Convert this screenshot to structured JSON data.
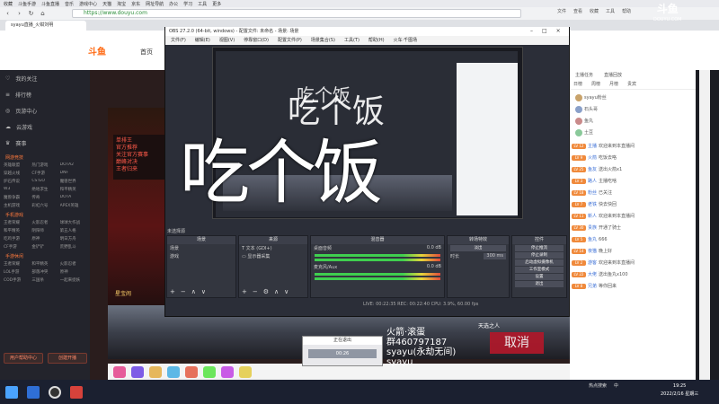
{
  "browser": {
    "bookmarks": [
      "收藏",
      "斗鱼手游",
      "斗鱼直播",
      "音乐",
      "游戏中心",
      "天猫",
      "淘宝",
      "京东",
      "网址导航",
      "办公",
      "学习",
      "工具",
      "更多"
    ],
    "url": "https://www.douyu.com",
    "top_right": [
      "文件",
      "查看",
      "收藏",
      "工具",
      "帮助"
    ],
    "tab_title": "syayu直播_火钳刘明",
    "nav": {
      "back": "‹",
      "forward": "›",
      "refresh": "↻",
      "home": "⌂"
    }
  },
  "douyu": {
    "logo": "斗鱼",
    "home": "首页",
    "sidebar_main": [
      "我的关注",
      "排行榜",
      "页游中心",
      "云游戏",
      "赛事"
    ],
    "sidebar_sections": [
      {
        "title": "网游竞技",
        "items": [
          "英雄联盟",
          "热门游戏",
          "DOTA2",
          "穿越火线",
          "CF手游",
          "DNF",
          "炉石传说",
          "CS:GO",
          "魔兽世界",
          "W3",
          "绝地求生",
          "和平精英",
          "魔兽争霸",
          "传奇",
          "DOTA",
          "主机游戏",
          "彩虹六号",
          "APEX英雄"
        ]
      },
      {
        "title": "手机游戏",
        "items": [
          "王者荣耀",
          "火影忍者",
          "球球大作战",
          "和平精英",
          "阴阳师",
          "第五人格",
          "吃鸡手游",
          "原神",
          "明日方舟",
          "CF手游",
          "金铲铲",
          "荒野乱斗"
        ]
      },
      {
        "title": "手游休闲",
        "items": [
          "王者荣耀",
          "和平精英",
          "火影忍者",
          "LOL手游",
          "部落冲突",
          "原神",
          "COD手游",
          "三国杀",
          "一起来捉妖"
        ]
      }
    ],
    "sidebar_buttons": [
      "用户帮助中心",
      "创建开播"
    ],
    "promo_lines": [
      "单排王",
      "官方推荐",
      "关注官方赛事",
      "巅峰对决",
      "王者归来"
    ],
    "stream_label": "星宝闹"
  },
  "obs": {
    "title": "OBS 27.2.0 (64-bit, windows) - 配置文件: 未命名 - 场景: 场景",
    "menu": [
      "文件(F)",
      "编辑(E)",
      "视图(V)",
      "停靠窗口(D)",
      "配置文件(P)",
      "场景集合(S)",
      "工具(T)",
      "帮助(H)",
      "火车·千图场"
    ],
    "preview_text": "吃个饭",
    "no_source_label": "未选择源",
    "docks": {
      "scenes": {
        "title": "场景",
        "items": [
          "场景",
          "游戏"
        ]
      },
      "sources": {
        "title": "来源",
        "items": [
          "文本 (GDI+)",
          "显示器采集"
        ]
      },
      "mixer": {
        "title": "混音器",
        "tracks": [
          {
            "name": "桌面音频",
            "db": "0.0 dB"
          },
          {
            "name": "麦克风/Aux",
            "db": "0.0 dB"
          }
        ]
      },
      "transitions": {
        "title": "转场特效",
        "type": "淡出",
        "duration_label": "时长",
        "duration": "300 ms"
      },
      "controls": {
        "title": "控件",
        "buttons": [
          "停止推流",
          "停止录制",
          "启动虚拟摄像机",
          "工作室模式",
          "设置",
          "退出"
        ]
      }
    },
    "status": "LIVE: 00:22:35    REC: 00:22:40    CPU: 3.9%, 60.00 fps"
  },
  "overlay": {
    "big_text": "吃个饭",
    "big_text_top": "吃个饭",
    "dialog_title": "正在退出",
    "dialog_time": "00:26",
    "signature": [
      "火箭·滚蛋",
      "群460797187",
      "syayu(永劫无间)",
      "syayu"
    ],
    "cancel": "取消",
    "tiantuo": "天选之人"
  },
  "right_panel": {
    "logo": "斗鱼",
    "logo_sub": "DOUYU.COM",
    "header_items": [
      "主播任务",
      "直播回放"
    ],
    "tabs": [
      "日榜",
      "周榜",
      "月榜",
      "贵宾"
    ],
    "rank_users": [
      "syayu粉丝",
      "石头哥",
      "鱼丸",
      "土豆"
    ],
    "chat": [
      {
        "lv": "LV 12",
        "nick": "主播",
        "text": "欢迎来到本直播间"
      },
      {
        "lv": "LV 9",
        "nick": "火箭",
        "text": "吃饭去咯"
      },
      {
        "lv": "LV 25",
        "nick": "鱼友",
        "text": "送出火箭x1"
      },
      {
        "lv": "LV 3",
        "nick": "路人",
        "text": "主播吃啥"
      },
      {
        "lv": "LV 18",
        "nick": "粉丝",
        "text": "已关注"
      },
      {
        "lv": "LV 7",
        "nick": "老铁",
        "text": "快去快回"
      },
      {
        "lv": "LV 11",
        "nick": "新人",
        "text": "欢迎来到本直播间"
      },
      {
        "lv": "LV 30",
        "nick": "贵族",
        "text": "开通了骑士"
      },
      {
        "lv": "LV 5",
        "nick": "鱼丸",
        "text": "666"
      },
      {
        "lv": "LV 14",
        "nick": "夜猫",
        "text": "晚上好"
      },
      {
        "lv": "LV 2",
        "nick": "游客",
        "text": "欢迎来到本直播间"
      },
      {
        "lv": "LV 22",
        "nick": "大佬",
        "text": "送出鱼丸x100"
      },
      {
        "lv": "LV 8",
        "nick": "兄弟",
        "text": "等你回来"
      }
    ]
  },
  "taskbar": {
    "tray": [
      "热点搜索",
      "中"
    ],
    "time": "19:25",
    "date": "2022/2/16 星期三"
  },
  "colors": {
    "accent": "#ff6a13",
    "live_red": "#e24b3b",
    "meter_green": "#3fcf4f"
  }
}
